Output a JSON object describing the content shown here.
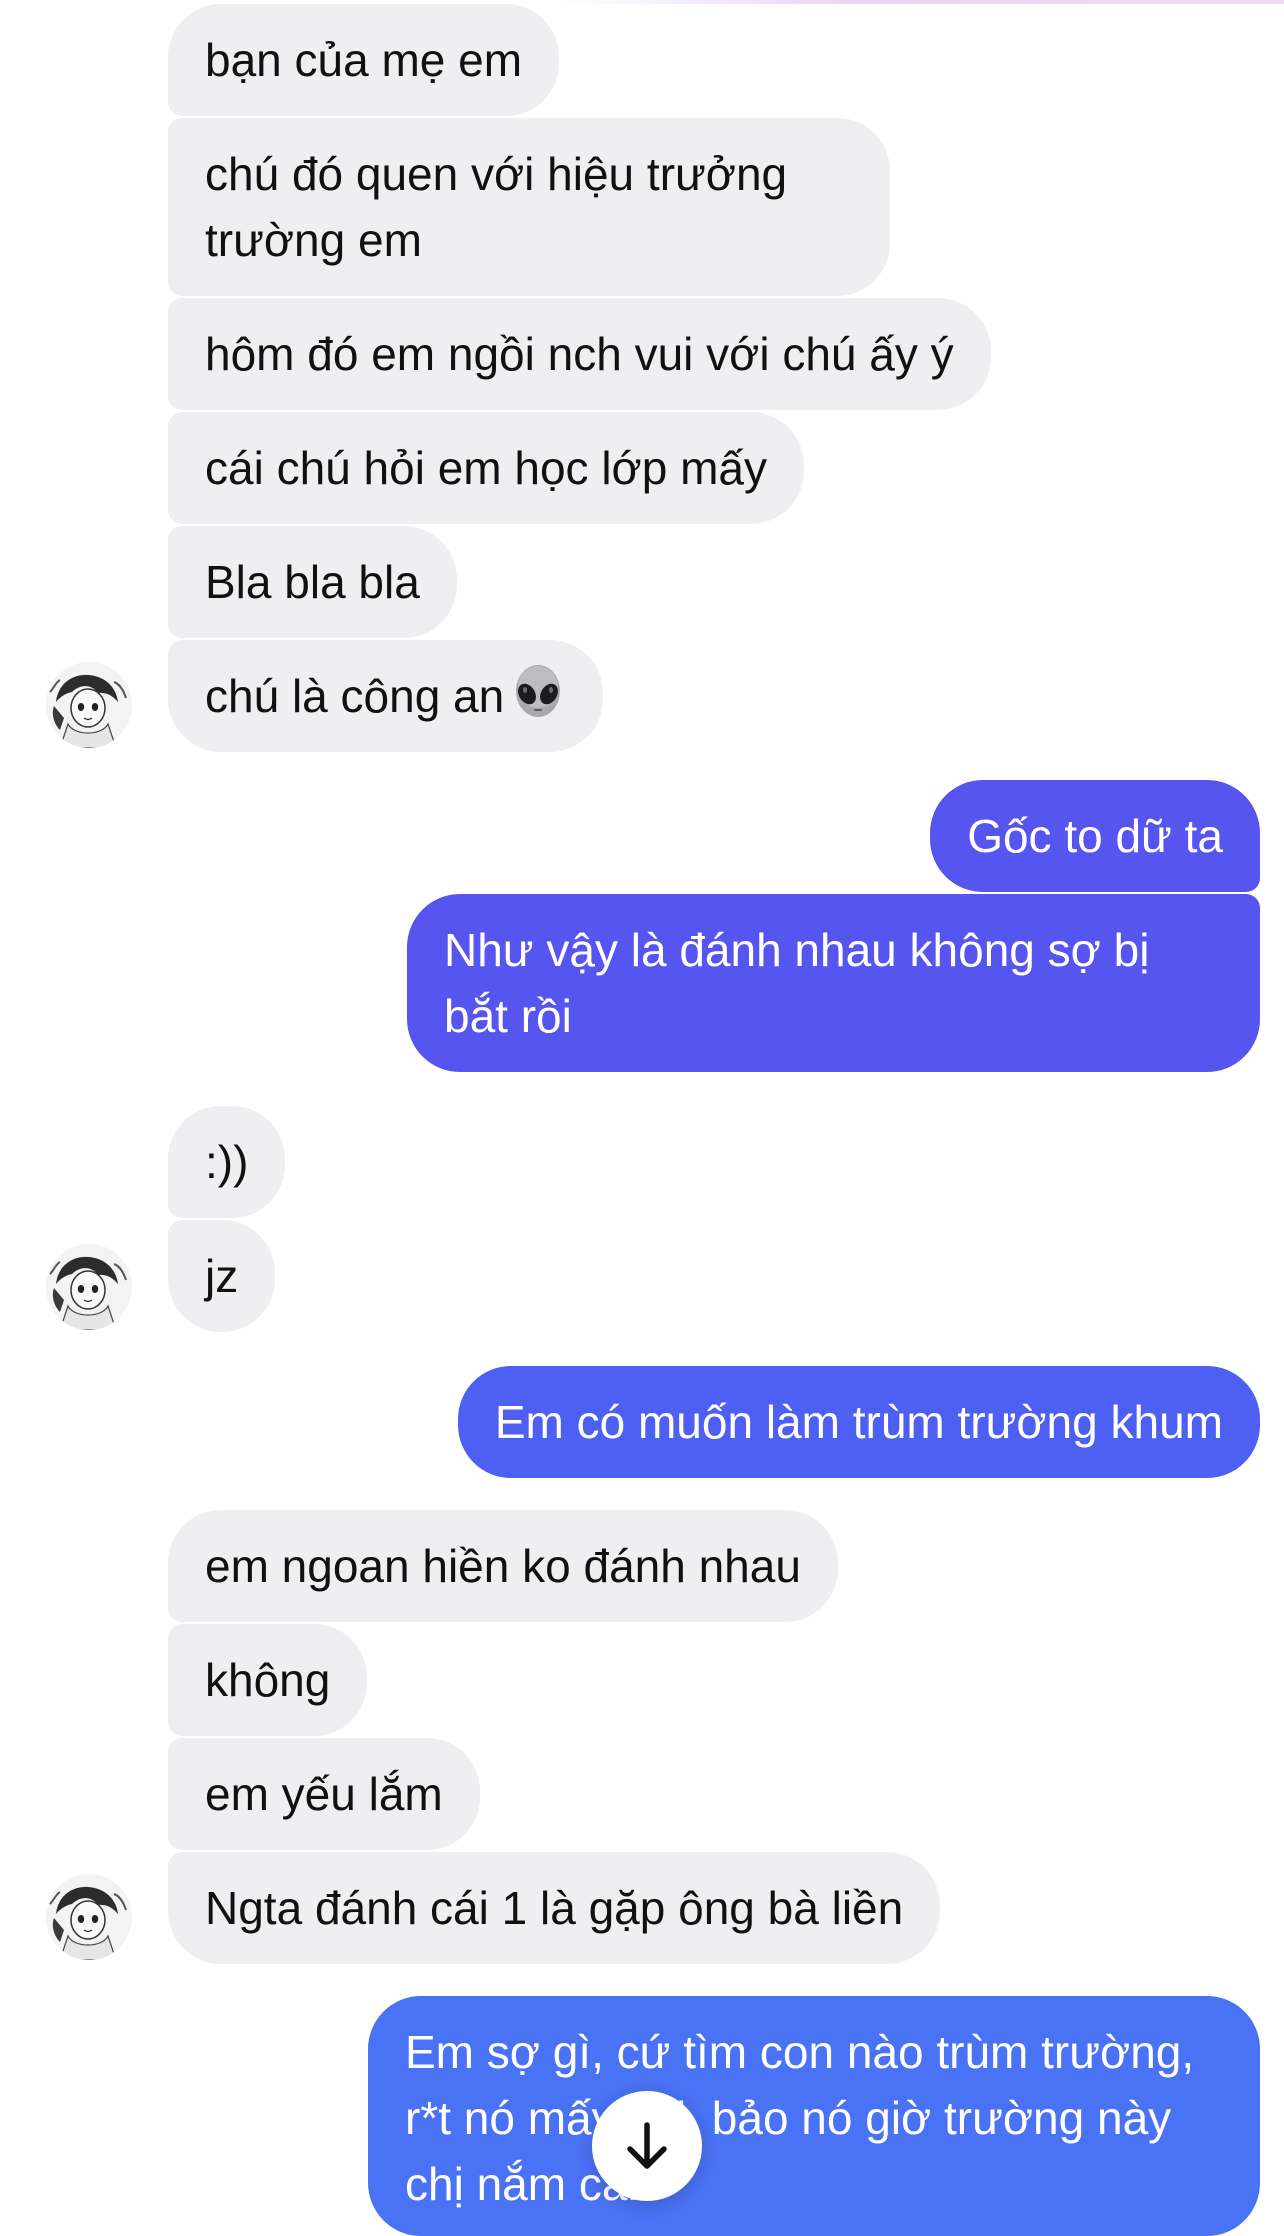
{
  "messages": [
    {
      "side": "in",
      "text": "bạn của mẹ em"
    },
    {
      "side": "in",
      "text": "chú đó quen với hiệu trưởng trường em"
    },
    {
      "side": "in",
      "text": "hôm đó em ngồi nch vui với chú ấy ý"
    },
    {
      "side": "in",
      "text": "cái chú hỏi em học lớp mấy"
    },
    {
      "side": "in",
      "text": "Bla bla bla"
    },
    {
      "side": "in",
      "text": "chú là công an",
      "emoji": "alien-emoji"
    },
    {
      "side": "out",
      "text": "Gốc to dữ ta"
    },
    {
      "side": "out",
      "text": "Như vậy là đánh nhau không sợ bị bắt rồi"
    },
    {
      "side": "in",
      "text": ":))"
    },
    {
      "side": "in",
      "text": "jz"
    },
    {
      "side": "out",
      "text": "Em có muốn làm trùm trường khum"
    },
    {
      "side": "in",
      "text": "em ngoan hiền ko đánh nhau"
    },
    {
      "side": "in",
      "text": "không"
    },
    {
      "side": "in",
      "text": "em yếu lắm"
    },
    {
      "side": "in",
      "text": "Ngta đánh cái 1 là gặp ông bà liền"
    },
    {
      "side": "out",
      "text": "Em sợ gì, cứ tìm con nào trùm trường, r*t nó mấy cái, bảo nó giờ trường này chị nắm cán"
    }
  ],
  "colors": {
    "incoming_bubble": "#efeff1",
    "incoming_text": "#111111",
    "outgoing_purple": "#5655ef",
    "outgoing_indigo": "#4e5ff4",
    "outgoing_blue": "#4a72f5",
    "outgoing_text": "#ffffff"
  },
  "icons": {
    "avatar": "contact-avatar-illustration",
    "emoji": "alien-emoji",
    "scroll_button": "arrow-down-icon"
  }
}
